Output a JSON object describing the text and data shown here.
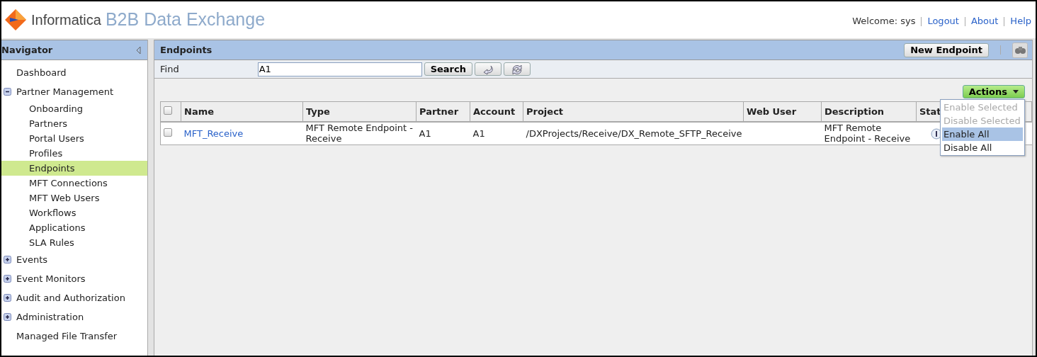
{
  "header": {
    "brand": "Informatica",
    "product": "B2B Data Exchange",
    "welcome": "Welcome: sys",
    "links": [
      "Logout",
      "About",
      "Help"
    ]
  },
  "navigator": {
    "title": "Navigator",
    "items": [
      {
        "label": "Dashboard",
        "selected": false
      },
      {
        "label": "Partner Management",
        "selected": false,
        "expanded": true,
        "children": [
          {
            "label": "Onboarding",
            "selected": false
          },
          {
            "label": "Partners",
            "selected": false
          },
          {
            "label": "Portal Users",
            "selected": false
          },
          {
            "label": "Profiles",
            "selected": false
          },
          {
            "label": "Endpoints",
            "selected": true
          },
          {
            "label": "MFT Connections",
            "selected": false
          },
          {
            "label": "MFT Web Users",
            "selected": false
          },
          {
            "label": "Workflows",
            "selected": false
          },
          {
            "label": "Applications",
            "selected": false
          },
          {
            "label": "SLA Rules",
            "selected": false
          }
        ]
      },
      {
        "label": "Events",
        "selected": false,
        "expanded": false
      },
      {
        "label": "Event Monitors",
        "selected": false,
        "expanded": false
      },
      {
        "label": "Audit and Authorization",
        "selected": false,
        "expanded": false
      },
      {
        "label": "Administration",
        "selected": false,
        "expanded": false
      },
      {
        "label": "Managed File Transfer",
        "selected": false
      }
    ]
  },
  "panel": {
    "title": "Endpoints",
    "new_button": "New Endpoint",
    "find_label": "Find",
    "find_value": "A1",
    "search_button": "Search",
    "actions": {
      "label": "Actions",
      "expanded": true,
      "items": [
        {
          "label": "Enable Selected",
          "disabled": true,
          "selected": false
        },
        {
          "label": "Disable Selected",
          "disabled": true,
          "selected": false
        },
        {
          "label": "Enable All",
          "disabled": false,
          "selected": true
        },
        {
          "label": "Disable All",
          "disabled": false,
          "selected": false
        }
      ]
    },
    "table": {
      "select_all_checked": false,
      "columns": [
        "Name",
        "Type",
        "Partner",
        "Account",
        "Project",
        "Web User",
        "Description",
        "Stat"
      ],
      "rows": [
        {
          "checked": false,
          "cells": [
            "MFT_Receive",
            "MFT Remote Endpoint - Receive",
            "A1",
            "A1",
            "/DXProjects/Receive/DX_Remote_SFTP_Receive",
            "",
            "MFT Remote Endpoint - Receive"
          ]
        }
      ]
    }
  }
}
